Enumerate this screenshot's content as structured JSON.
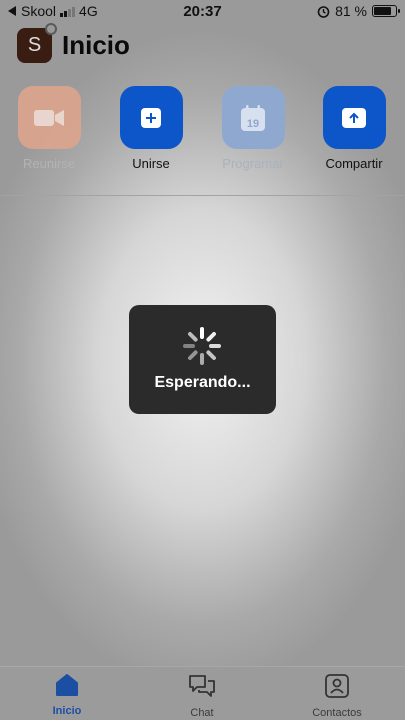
{
  "status_bar": {
    "carrier": "Skool",
    "network": "4G",
    "time": "20:37",
    "battery": "81 %"
  },
  "header": {
    "avatar_initial": "S",
    "title": "Inicio"
  },
  "actions": [
    {
      "label": "Reunirse",
      "icon": "video-camera-icon",
      "enabled": false
    },
    {
      "label": "Unirse",
      "icon": "plus-icon",
      "enabled": true
    },
    {
      "label": "Programar",
      "icon": "calendar-icon",
      "calendar_day": "19",
      "enabled": false
    },
    {
      "label": "Compartir",
      "icon": "share-up-arrow-icon",
      "enabled": true
    }
  ],
  "hud": {
    "text": "Esperando..."
  },
  "tabbar": {
    "tabs": [
      {
        "label": "Inicio",
        "icon": "home-icon",
        "active": true
      },
      {
        "label": "Chat",
        "icon": "chat-bubbles-icon",
        "active": false
      },
      {
        "label": "Contactos",
        "icon": "contact-card-icon",
        "active": false
      }
    ]
  },
  "colors": {
    "accent_blue": "#0d56c9",
    "disabled_orange": "#e0a58c",
    "disabled_blue": "#8fa8cf",
    "active_tab": "#1c4fa3"
  }
}
